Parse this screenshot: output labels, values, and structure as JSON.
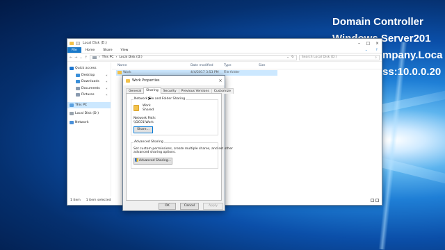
{
  "overlay": {
    "lines": [
      "Domain Controller",
      "Windows Server201",
      "mpany.Loca",
      "ss:10.0.0.20"
    ]
  },
  "explorer": {
    "title": "Local Disk (D:)",
    "ribbon_tabs": [
      "File",
      "Home",
      "Share",
      "View"
    ],
    "breadcrumb": [
      "This PC",
      "Local Disk (D:)"
    ],
    "search_placeholder": "Search Local Disk (D:)",
    "nav_items": [
      {
        "label": "Quick access",
        "icon": "star-icon",
        "color": "#1f77d0"
      },
      {
        "label": "Desktop",
        "icon": "desktop-icon",
        "color": "#3a8fd9"
      },
      {
        "label": "Downloads",
        "icon": "download-icon",
        "color": "#3a8fd9"
      },
      {
        "label": "Documents",
        "icon": "documents-icon",
        "color": "#8a9bb0"
      },
      {
        "label": "Pictures",
        "icon": "pictures-icon",
        "color": "#8a9bb0"
      },
      {
        "label": "This PC",
        "icon": "computer-icon",
        "color": "#5aa0e0"
      },
      {
        "label": "Local Disk (D:)",
        "icon": "drive-icon",
        "color": "#9aa4ae"
      },
      {
        "label": "Network",
        "icon": "network-icon",
        "color": "#4a90d9"
      }
    ],
    "columns": [
      "Name",
      "Date modified",
      "Type",
      "Size"
    ],
    "files": [
      {
        "name": "Work",
        "date": "4/4/2017 3:53 PM",
        "type": "File folder",
        "size": ""
      }
    ],
    "status": {
      "count": "1 item",
      "selected": "1 item selected"
    }
  },
  "dialog": {
    "title": "Work Properties",
    "tabs": [
      "General",
      "Sharing",
      "Security",
      "Previous Versions",
      "Customize"
    ],
    "active_tab": "Sharing",
    "network_group_label": "Network File and Folder Sharing",
    "folder_name": "Work",
    "folder_state": "Shared",
    "network_path_label": "Network Path:",
    "network_path": "\\\\DC01\\Work",
    "share_button": "Share...",
    "advanced_group_label": "Advanced Sharing",
    "advanced_text": [
      "Set custom permissions, create multiple shares, and set other",
      "advanced sharing options."
    ],
    "advanced_button": "Advanced Sharing...",
    "ok": "OK",
    "cancel": "Cancel",
    "apply": "Apply"
  },
  "colors": {
    "accent": "#1979ca",
    "selection": "#cce8ff",
    "folder": "#f3c24b"
  }
}
